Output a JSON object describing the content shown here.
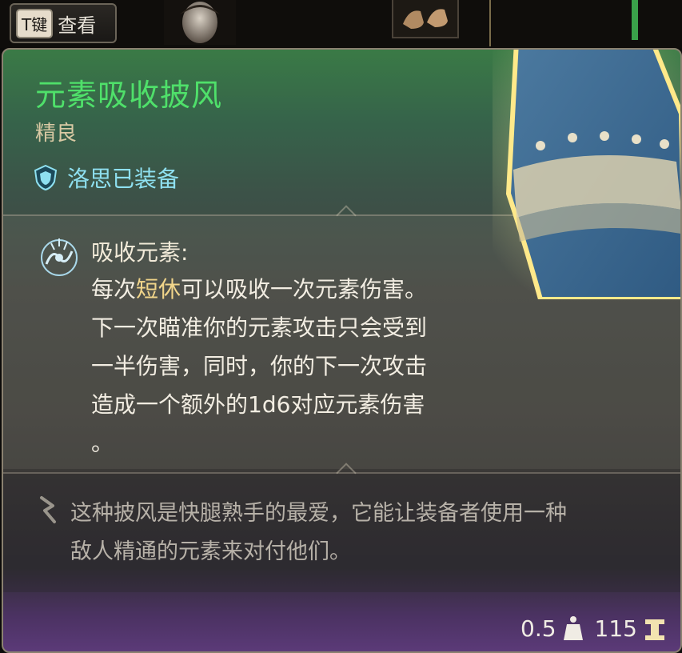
{
  "topbar": {
    "key_label": "T键",
    "view_label": "查看"
  },
  "item": {
    "name": "元素吸收披风",
    "rarity": "精良",
    "equipped_by": "洛思已装备"
  },
  "ability": {
    "name": "吸收元素:",
    "lines": [
      {
        "pre": "每次",
        "hl": "短休",
        "post": "可以吸收一次元素伤害。"
      },
      {
        "text": "下一次瞄准你的元素攻击只会受到"
      },
      {
        "text": "一半伤害，同时，你的下一次攻击"
      },
      {
        "text": "造成一个额外的1d6对应元素伤害"
      },
      {
        "text": "。"
      }
    ]
  },
  "flavor": {
    "line1": "这种披风是快腿熟手的最爱，它能让装备者使用一种",
    "line2": "敌人精通的元素来对付他们。"
  },
  "footer": {
    "weight": "0.5",
    "weight_icon": "weight-icon",
    "value": "115",
    "value_icon": "gold-icon"
  },
  "colors": {
    "title": "#4fe06a",
    "rarity": "#d9c9a4",
    "equipped": "#8ee0f0",
    "highlight": "#f1d58a"
  }
}
